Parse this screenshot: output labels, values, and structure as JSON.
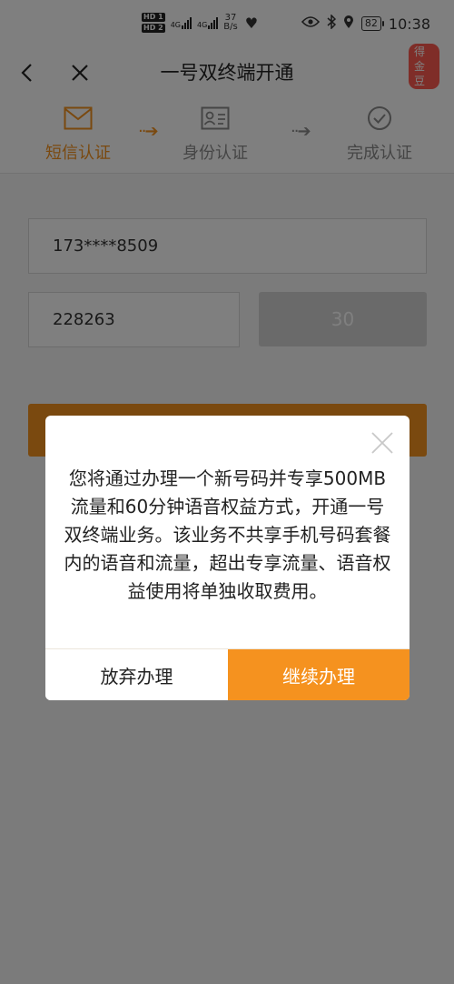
{
  "status_bar": {
    "hd1": "HD 1",
    "hd2": "HD 2",
    "net1": "4G",
    "net2": "4G",
    "speed_value": "37",
    "speed_unit": "B/s",
    "battery": "82",
    "time": "10:38",
    "icons": [
      "eye-icon",
      "bluetooth-icon",
      "location-icon",
      "heart-rate-icon"
    ]
  },
  "header": {
    "title": "一号双终端开通",
    "badge": "得金豆",
    "back_icon": "chevron-left-icon",
    "close_icon": "close-icon",
    "share_icon": "share-icon"
  },
  "steps": [
    {
      "label": "短信认证",
      "icon": "mail-icon",
      "state": "active"
    },
    {
      "label": "身份认证",
      "icon": "id-card-icon",
      "state": "inactive"
    },
    {
      "label": "完成认证",
      "icon": "check-circle-icon",
      "state": "inactive"
    }
  ],
  "form": {
    "phone": "173****8509",
    "code": "228263",
    "countdown": "30"
  },
  "dialog": {
    "message": "您将通过办理一个新号码并专享500MB流量和60分钟语音权益方式，开通一号双终端业务。该业务不共享手机号码套餐内的语音和流量，超出专享流量、语音权益使用将单独收取费用。",
    "cancel_label": "放弃办理",
    "confirm_label": "继续办理"
  },
  "colors": {
    "accent": "#f5921f",
    "badge": "#ff5b50",
    "overlay": "rgba(0,0,0,0.5)"
  }
}
